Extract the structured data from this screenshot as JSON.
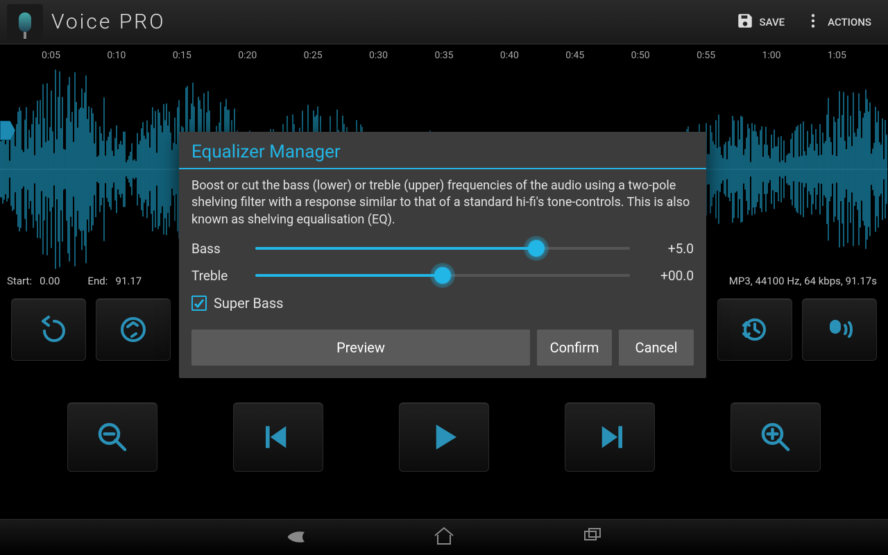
{
  "header": {
    "title": "Voice PRO",
    "save_label": "SAVE",
    "actions_label": "ACTIONS"
  },
  "ruler": [
    "0:05",
    "0:10",
    "0:15",
    "0:20",
    "0:25",
    "0:30",
    "0:35",
    "0:40",
    "0:45",
    "0:50",
    "0:55",
    "1:00",
    "1:05"
  ],
  "info": {
    "start_label": "Start:",
    "start_value": "0.00",
    "end_label": "End:",
    "end_value": "91.17",
    "audio_info": "MP3, 44100 Hz, 64 kbps, 91.17s"
  },
  "dialog": {
    "title": "Equalizer Manager",
    "description": "Boost or cut the bass (lower) or treble (upper) frequencies of the audio using a two-pole shelving filter with a response similar to that of a standard hi-fi's tone-controls. This is also known as shelving equalisation (EQ).",
    "bass_label": "Bass",
    "bass_value": "+5.0",
    "bass_percent": 75,
    "treble_label": "Treble",
    "treble_value": "+00.0",
    "treble_percent": 50,
    "superbass_label": "Super Bass",
    "superbass_checked": true,
    "preview_label": "Preview",
    "confirm_label": "Confirm",
    "cancel_label": "Cancel"
  },
  "colors": {
    "accent": "#22b6e6",
    "wave": "#1a8aad"
  }
}
